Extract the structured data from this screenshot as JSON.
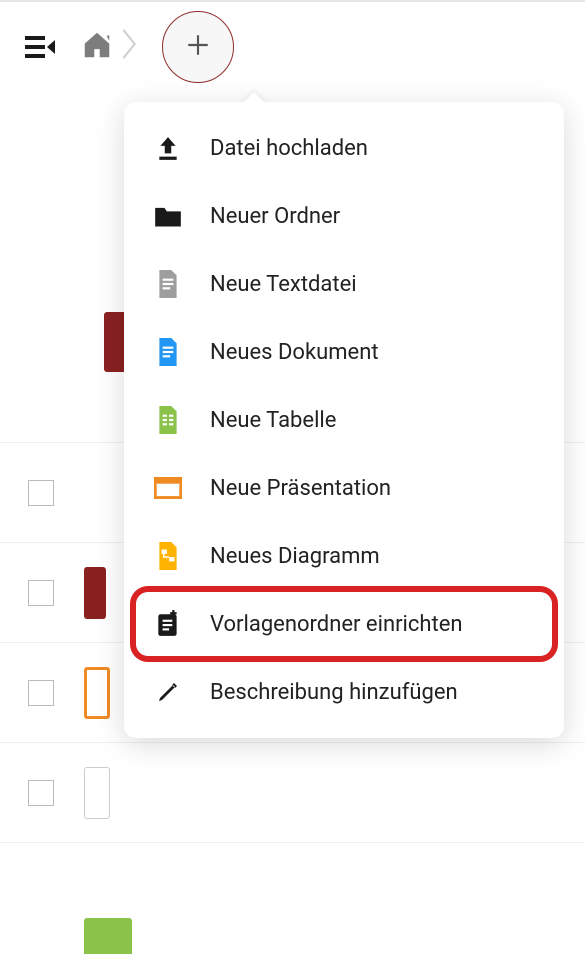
{
  "menu": {
    "items": [
      {
        "label": "Datei hochladen",
        "icon": "upload-icon"
      },
      {
        "label": "Neuer Ordner",
        "icon": "folder-icon"
      },
      {
        "label": "Neue Textdatei",
        "icon": "text-file-icon"
      },
      {
        "label": "Neues Dokument",
        "icon": "document-icon"
      },
      {
        "label": "Neue Tabelle",
        "icon": "spreadsheet-icon"
      },
      {
        "label": "Neue Präsentation",
        "icon": "presentation-icon"
      },
      {
        "label": "Neues Diagramm",
        "icon": "diagram-icon"
      },
      {
        "label": "Vorlagenordner einrichten",
        "icon": "template-icon"
      },
      {
        "label": "Beschreibung hinzufügen",
        "icon": "pencil-icon"
      }
    ]
  },
  "colors": {
    "folder": "#1a1a1a",
    "text_file": "#9e9e9e",
    "document": "#2196f3",
    "spreadsheet": "#8bc34a",
    "presentation": "#f08a24",
    "diagram": "#ffb300",
    "accent_border": "#8d2d2d",
    "highlight": "#d92222"
  },
  "highlighted_item_index": 7
}
